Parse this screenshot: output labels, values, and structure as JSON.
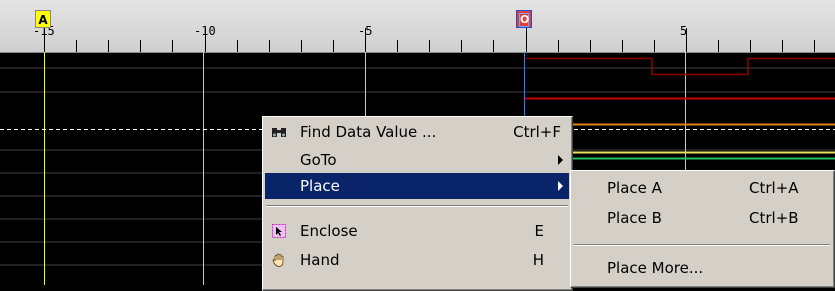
{
  "ruler": {
    "tick_labels": [
      "-15",
      "-10",
      "-5",
      "0",
      "5"
    ],
    "marker_a_label": "A",
    "marker_b_label": "O"
  },
  "context_menu": {
    "items": [
      {
        "label": "Find Data Value ...",
        "shortcut": "Ctrl+F",
        "icon": "binoculars-icon"
      },
      {
        "label": "GoTo",
        "submenu": true
      },
      {
        "label": "Place",
        "submenu": true,
        "selected": true
      },
      {
        "label": "Enclose",
        "shortcut": "E",
        "icon": "enclose-icon"
      },
      {
        "label": "Hand",
        "shortcut": "H",
        "icon": "hand-icon"
      }
    ]
  },
  "submenu": {
    "items": [
      {
        "label": "Place A",
        "shortcut": "Ctrl+A"
      },
      {
        "label": "Place B",
        "shortcut": "Ctrl+B"
      },
      {
        "label": "Place More..."
      }
    ]
  },
  "colors": {
    "background": "#000000",
    "grid": "#c8c8c8",
    "marker_a": "#ffff00",
    "marker_b": "#e43d34",
    "selection": "#0a246a",
    "menu_bg": "#d4d0c8",
    "trace_red": "#cc0000",
    "trace_dark_red": "#8b0000",
    "trace_orange": "#e08020",
    "trace_yellow": "#e8e060",
    "trace_green": "#20c060"
  }
}
